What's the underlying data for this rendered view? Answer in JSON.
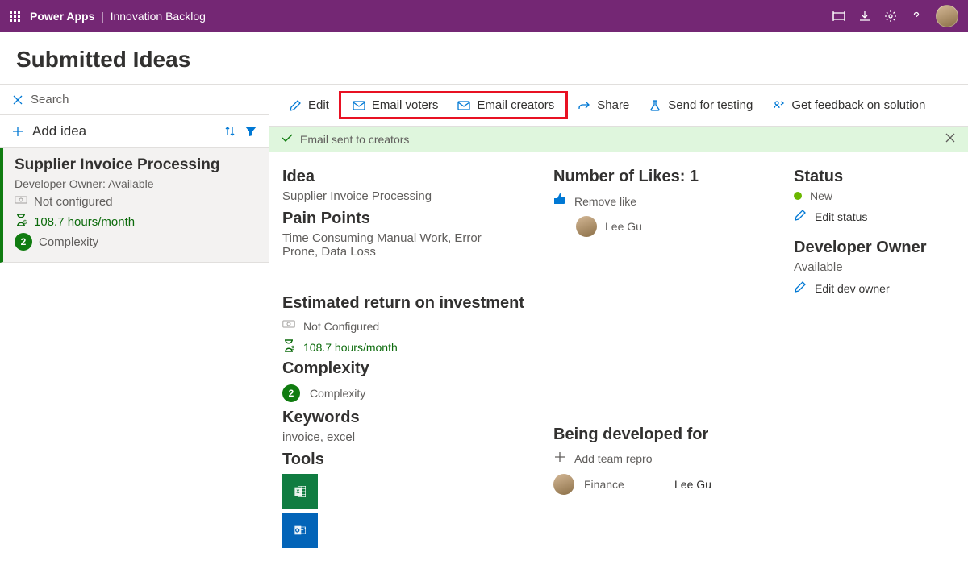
{
  "header": {
    "app_brand": "Power Apps",
    "app_name": "Innovation Backlog"
  },
  "page": {
    "title": "Submitted Ideas"
  },
  "search": {
    "placeholder": "Search"
  },
  "add_idea": {
    "label": "Add idea"
  },
  "idea_card": {
    "title": "Supplier Invoice Processing",
    "owner_label": "Developer Owner: Available",
    "not_configured": "Not configured",
    "hours": "108.7 hours/month",
    "complexity_number": "2",
    "complexity_label": "Complexity"
  },
  "toolbar": {
    "edit": "Edit",
    "email_voters": "Email voters",
    "email_creators": "Email creators",
    "share": "Share",
    "send_for_testing": "Send for testing",
    "get_feedback": "Get feedback on solution"
  },
  "status_message": "Email sent to creators",
  "detail": {
    "idea": {
      "heading": "Idea",
      "value": "Supplier Invoice Processing"
    },
    "pain_points": {
      "heading": "Pain Points",
      "value": "Time Consuming Manual Work, Error Prone, Data Loss"
    },
    "roi": {
      "heading": "Estimated return on investment",
      "not_configured": "Not Configured",
      "hours": "108.7 hours/month"
    },
    "complexity": {
      "heading": "Complexity",
      "number": "2",
      "label": "Complexity"
    },
    "keywords": {
      "heading": "Keywords",
      "value": "invoice, excel"
    },
    "tools": {
      "heading": "Tools"
    },
    "likes": {
      "heading": "Number of Likes: 1",
      "remove": "Remove like",
      "user": "Lee Gu"
    },
    "being_developed": {
      "heading": "Being developed for",
      "add_team": "Add team repro",
      "team": "Finance",
      "user": "Lee Gu"
    },
    "status": {
      "heading": "Status",
      "value": "New",
      "edit": "Edit status"
    },
    "dev_owner": {
      "heading": "Developer Owner",
      "value": "Available",
      "edit": "Edit dev owner"
    }
  }
}
